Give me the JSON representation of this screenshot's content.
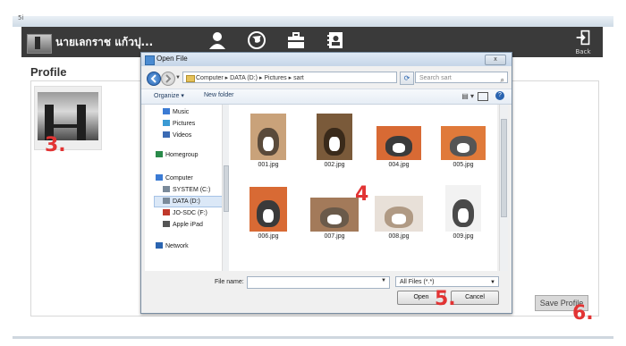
{
  "app": {
    "user_name": "นายเลกราช แก้วปุ...",
    "back_label": "Back",
    "profile_title": "Profile",
    "save_profile_label": "Save Profile",
    "top_mark": "5i"
  },
  "annotations": {
    "step3": "3.",
    "step4": "4",
    "step5": "5.",
    "step6": "6."
  },
  "dialog": {
    "title": "Open File",
    "close_label": "x",
    "breadcrumb": "Computer  ▸  DATA (D:)  ▸  Pictures  ▸  sart",
    "search_placeholder": "Search sart",
    "toolbar": {
      "organize": "Organize ▾",
      "new_folder": "New folder"
    },
    "nav_items": [
      {
        "label": "Music",
        "icon": "music-icon",
        "color": "#3b7bd4"
      },
      {
        "label": "Pictures",
        "icon": "pictures-icon",
        "color": "#3b9bd4"
      },
      {
        "label": "Videos",
        "icon": "videos-icon",
        "color": "#3b6bb4"
      },
      {
        "label": "Homegroup",
        "icon": "homegroup-icon",
        "color": "#2a8a4a"
      },
      {
        "label": "Computer",
        "icon": "computer-icon",
        "color": "#3b7bd4"
      },
      {
        "label": "SYSTEM (C:)",
        "icon": "drive-icon",
        "color": "#7a8a9a"
      },
      {
        "label": "DATA (D:)",
        "icon": "drive-icon",
        "color": "#7a8a9a"
      },
      {
        "label": "JO-SDC (F:)",
        "icon": "usb-drive-icon",
        "color": "#c0392b"
      },
      {
        "label": "Apple iPad",
        "icon": "ipad-icon",
        "color": "#555555"
      },
      {
        "label": "Network",
        "icon": "network-icon",
        "color": "#2a64b0"
      }
    ],
    "files": [
      {
        "name": "001.jpg",
        "bg": "#c9a27a",
        "dog": "#5a4a3a"
      },
      {
        "name": "002.jpg",
        "bg": "#7a5a3a",
        "dog": "#3a2a1a"
      },
      {
        "name": "004.jpg",
        "bg": "#d86a34",
        "dog": "#3a3a3a"
      },
      {
        "name": "005.jpg",
        "bg": "#e07a3a",
        "dog": "#555555"
      },
      {
        "name": "006.jpg",
        "bg": "#d86a34",
        "dog": "#3a3a3a"
      },
      {
        "name": "007.jpg",
        "bg": "#a37a5a",
        "dog": "#6a5a4a"
      },
      {
        "name": "008.jpg",
        "bg": "#e8e0d8",
        "dog": "#b09a84"
      },
      {
        "name": "009.jpg",
        "bg": "#f2f2f2",
        "dog": "#4a4a4a"
      },
      {
        "name": "",
        "bg": "#8a9a5a",
        "dog": "#f0ead8"
      },
      {
        "name": "",
        "bg": "#b9a07a",
        "dog": "#f4ecdc"
      },
      {
        "name": "",
        "bg": "#7a8a4a",
        "dog": "#ede0c4"
      },
      {
        "name": "",
        "bg": "#c9b48a",
        "dog": "#7a6a5a"
      }
    ],
    "file_name_label": "File name:",
    "file_name_value": "",
    "filter_value": "All Files (*.*)",
    "open_label": "Open",
    "cancel_label": "Cancel"
  },
  "colors": {
    "header_bg": "#3a3a3a",
    "annotation": "#e23434"
  }
}
